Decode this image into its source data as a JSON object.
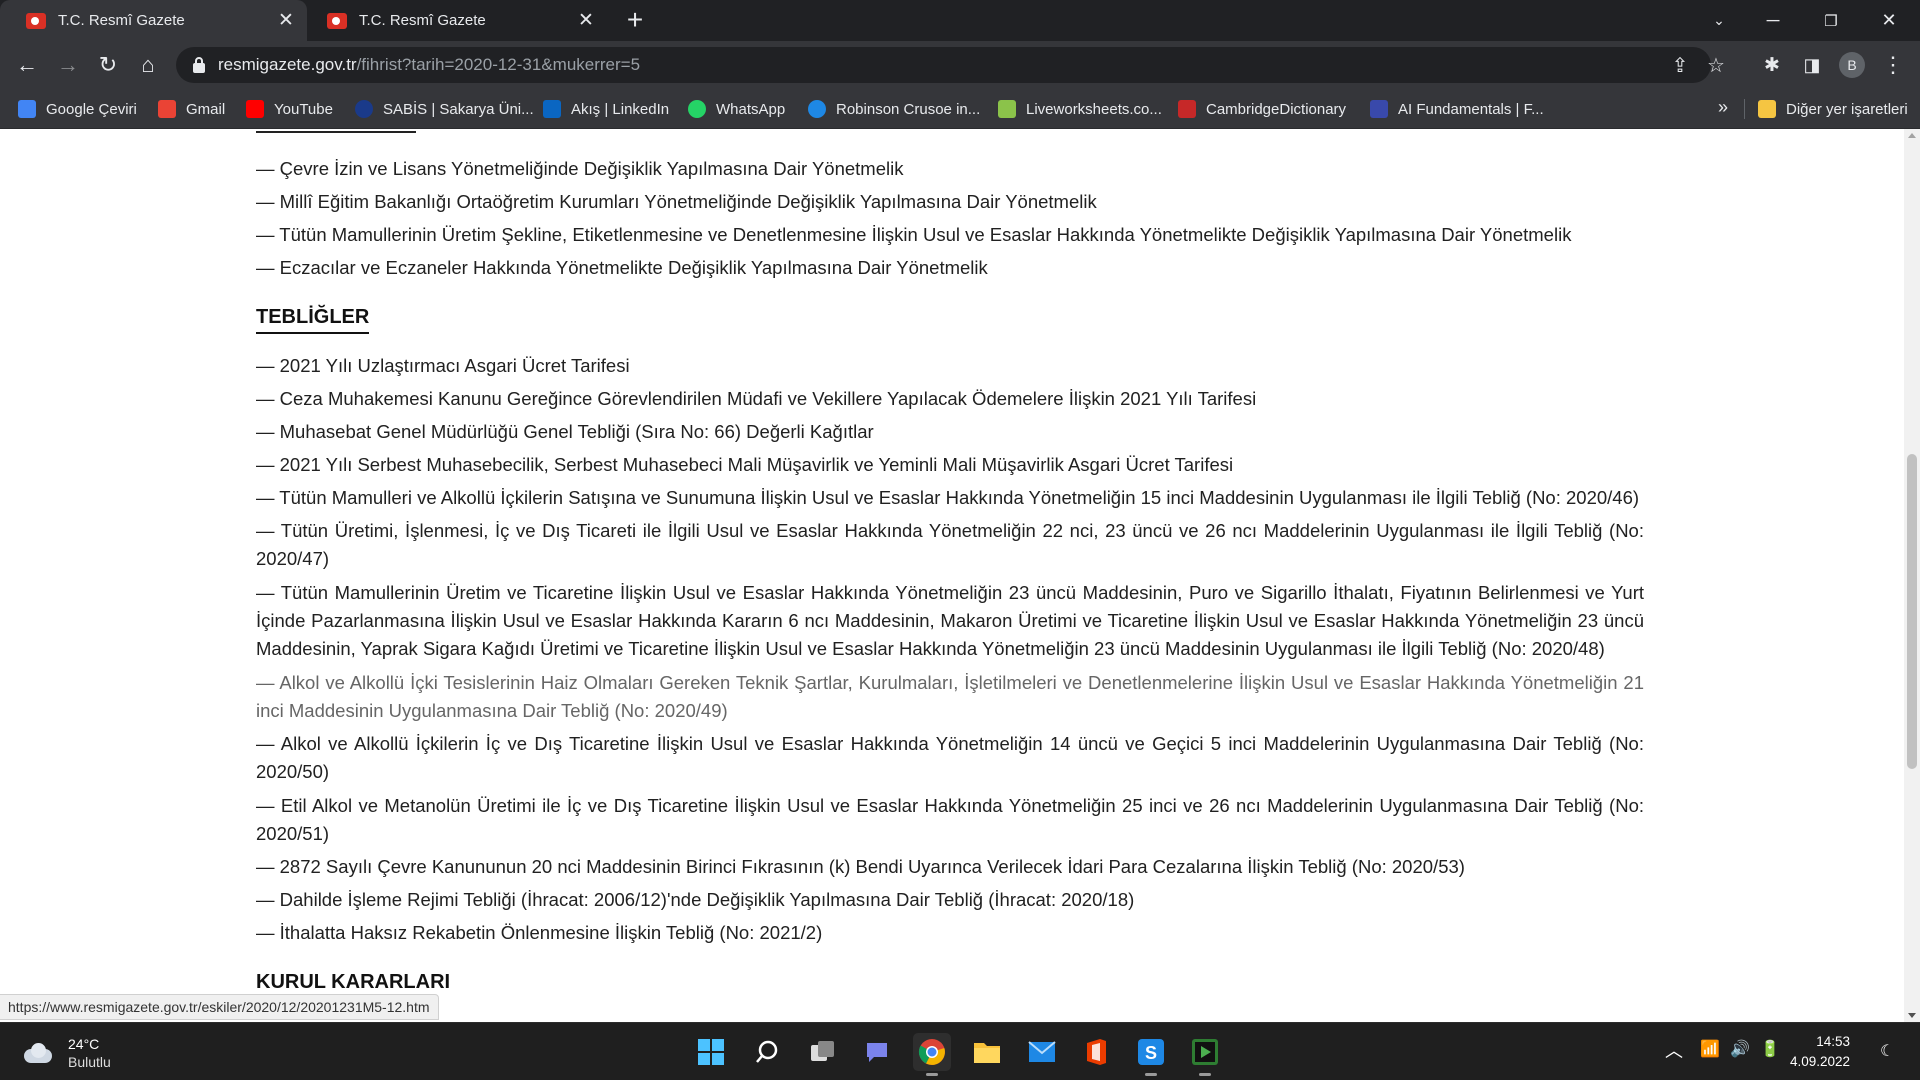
{
  "browser": {
    "tabs": [
      {
        "title": "T.C. Resmî Gazete",
        "active": true
      },
      {
        "title": "T.C. Resmî Gazete",
        "active": false
      }
    ],
    "url_host": "resmigazete.gov.tr",
    "url_path": "/fihrist?tarih=2020-12-31&mukerrer=5",
    "profile_initial": "B",
    "bookmarks": [
      {
        "label": "Google Çeviri",
        "icon": "google-translate-icon",
        "color": "#4285f4"
      },
      {
        "label": "Gmail",
        "icon": "gmail-icon",
        "color": "#ea4335"
      },
      {
        "label": "YouTube",
        "icon": "youtube-icon",
        "color": "#ff0000"
      },
      {
        "label": "SABİS | Sakarya Üni...",
        "icon": "sabis-icon",
        "color": "#1a3a8a"
      },
      {
        "label": "Akış | LinkedIn",
        "icon": "linkedin-icon",
        "color": "#0a66c2"
      },
      {
        "label": "WhatsApp",
        "icon": "whatsapp-icon",
        "color": "#25d366"
      },
      {
        "label": "Robinson Crusoe in...",
        "icon": "site-icon",
        "color": "#1e88e5"
      },
      {
        "label": "Liveworksheets.co...",
        "icon": "liveworksheets-icon",
        "color": "#8bc34a"
      },
      {
        "label": "CambridgeDictionary",
        "icon": "cambridge-icon",
        "color": "#c62828"
      },
      {
        "label": "AI Fundamentals | F...",
        "icon": "ai-icon",
        "color": "#3949ab"
      }
    ],
    "other_bookmarks": "Diğer yer işaretleri",
    "more": "»"
  },
  "page": {
    "yonetmelikler": [
      "— Çevre İzin ve Lisans Yönetmeliğinde Değişiklik Yapılmasına Dair Yönetmelik",
      "— Millî Eğitim Bakanlığı Ortaöğretim Kurumları Yönetmeliğinde Değişiklik Yapılmasına Dair Yönetmelik",
      "— Tütün Mamullerinin Üretim Şekline, Etiketlenmesine ve Denetlenmesine İlişkin Usul ve Esaslar Hakkında Yönetmelikte Değişiklik Yapılmasına Dair Yönetmelik",
      "— Eczacılar ve Eczaneler Hakkında Yönetmelikte Değişiklik Yapılmasına Dair Yönetmelik"
    ],
    "tebligler_heading": "TEBLİĞLER",
    "tebligler": [
      "— 2021 Yılı Uzlaştırmacı Asgari Ücret Tarifesi",
      "— Ceza Muhakemesi Kanunu Gereğince Görevlendirilen Müdafi ve Vekillere Yapılacak Ödemelere İlişkin 2021 Yılı Tarifesi",
      "— Muhasebat Genel Müdürlüğü Genel Tebliği (Sıra No: 66) Değerli Kağıtlar",
      "— 2021 Yılı Serbest Muhasebecilik, Serbest Muhasebeci Mali Müşavirlik ve Yeminli Mali Müşavirlik Asgari Ücret Tarifesi",
      "— Tütün Mamulleri ve Alkollü İçkilerin Satışına ve Sunumuna İlişkin Usul ve Esaslar Hakkında Yönetmeliğin 15 inci Maddesinin Uygulanması ile İlgili Tebliğ (No: 2020/46)",
      "— Tütün Üretimi, İşlenmesi, İç ve Dış Ticareti ile İlgili Usul ve Esaslar Hakkında Yönetmeliğin 22 nci, 23 üncü ve 26 ncı Maddelerinin Uygulanması ile İlgili Tebliğ (No: 2020/47)",
      "— Tütün Mamullerinin Üretim ve Ticaretine İlişkin Usul ve Esaslar Hakkında Yönetmeliğin 23 üncü Maddesinin, Puro ve Sigarillo İthalatı, Fiyatının Belirlenmesi ve Yurt İçinde Pazarlanmasına İlişkin Usul ve Esaslar Hakkında Kararın 6 ncı Maddesinin, Makaron Üretimi ve Ticaretine İlişkin Usul ve Esaslar Hakkında Yönetmeliğin 23 üncü Maddesinin, Yaprak Sigara Kağıdı Üretimi ve Ticaretine İlişkin Usul ve Esaslar Hakkında Yönetmeliğin 23 üncü Maddesinin Uygulanması ile İlgili Tebliğ (No: 2020/48)",
      "— Alkol ve Alkollü İçki Tesislerinin Haiz Olmaları Gereken Teknik Şartlar, Kurulmaları, İşletilmeleri ve Denetlenmelerine İlişkin Usul ve Esaslar Hakkında Yönetmeliğin 21 inci Maddesinin Uygulanmasına Dair Tebliğ (No: 2020/49)",
      "— Alkol ve Alkollü İçkilerin İç ve Dış Ticaretine İlişkin Usul ve Esaslar Hakkında Yönetmeliğin 14 üncü ve Geçici 5 inci Maddelerinin Uygulanmasına Dair Tebliğ (No: 2020/50)",
      "— Etil Alkol ve Metanolün Üretimi ile İç ve Dış Ticaretine İlişkin Usul ve Esaslar Hakkında Yönetmeliğin 25 inci ve 26 ncı Maddelerinin Uygulanmasına Dair Tebliğ (No: 2020/51)",
      "— 2872 Sayılı Çevre Kanununun 20 nci Maddesinin Birinci Fıkrasının (k) Bendi Uyarınca Verilecek İdari Para Cezalarına İlişkin Tebliğ (No: 2020/53)",
      "— Dahilde İşleme Rejimi Tebliği (İhracat: 2006/12)'nde Değişiklik Yapılmasına Dair Tebliğ (İhracat: 2020/18)",
      "— İthalatta Haksız Rekabetin Önlenmesine İlişkin Tebliğ (No: 2021/2)"
    ],
    "kurul_heading": "KURUL KARARLARI"
  },
  "status_url": "https://www.resmigazete.gov.tr/eskiler/2020/12/20201231M5-12.htm",
  "taskbar": {
    "temperature": "24°C",
    "weather": "Bulutlu",
    "time": "14:53",
    "date": "4.09.2022"
  }
}
